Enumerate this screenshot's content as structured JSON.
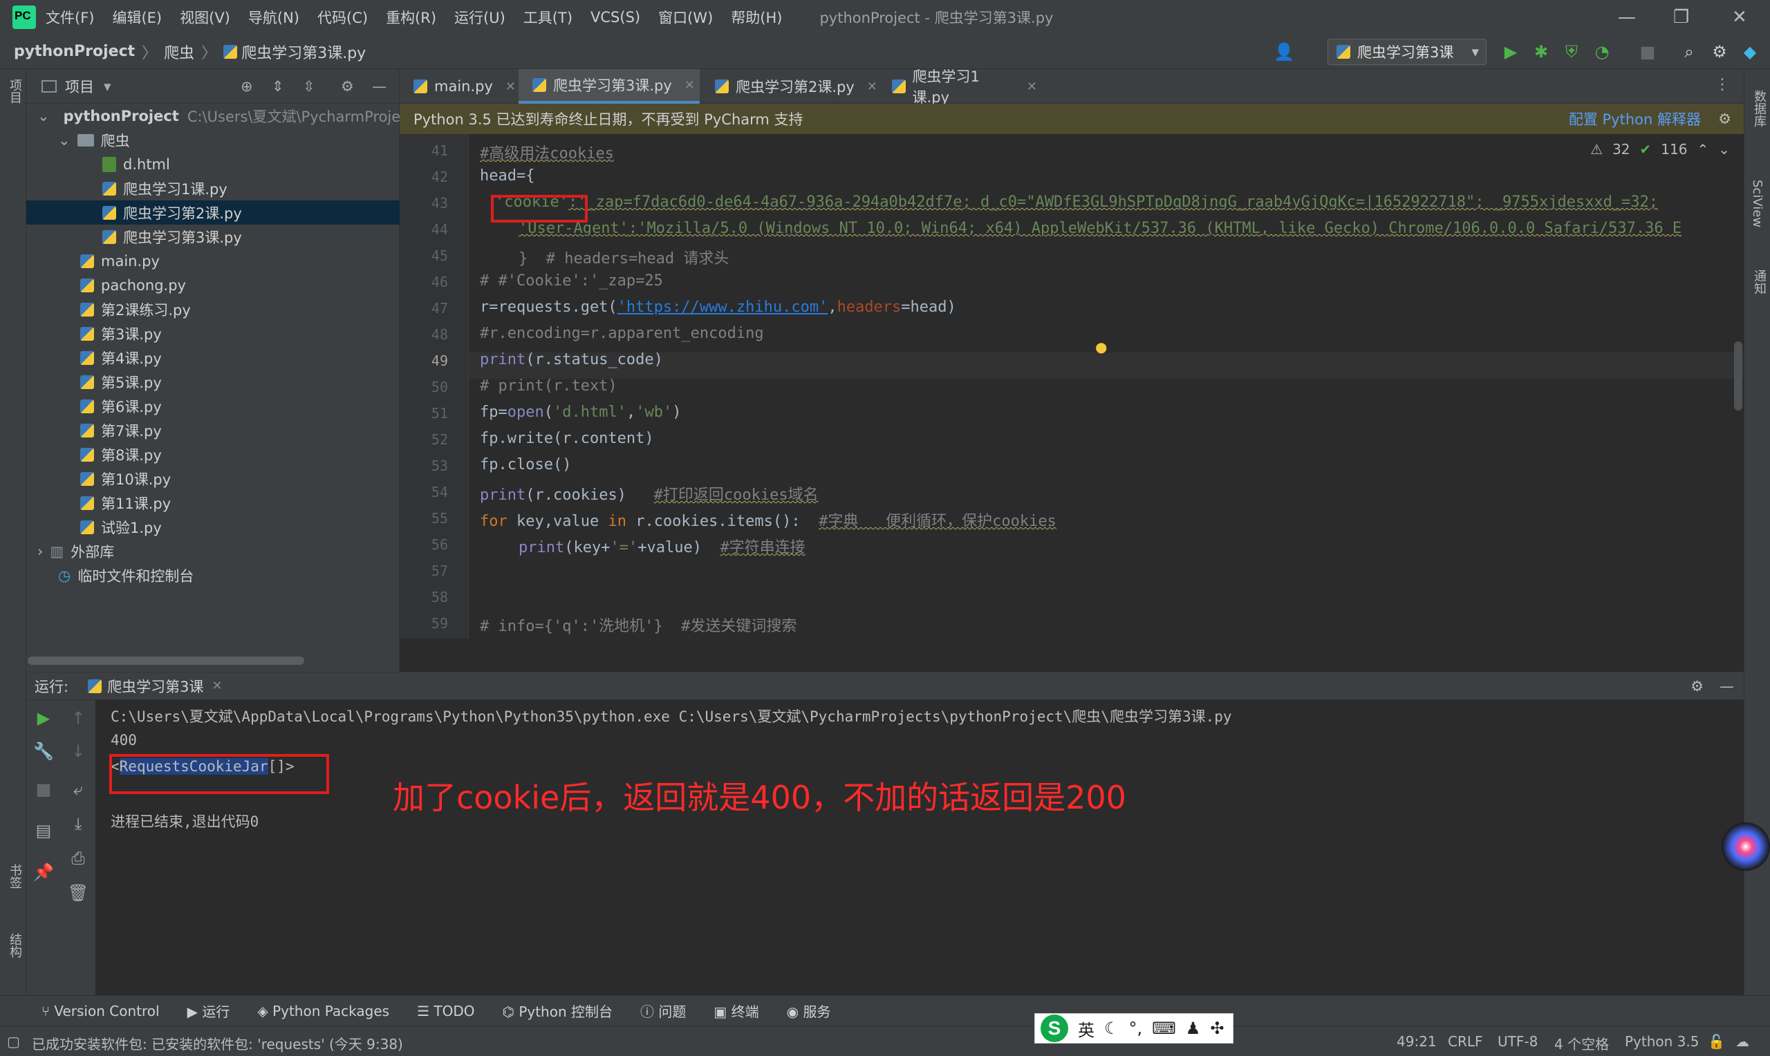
{
  "menubar": {
    "items": [
      "文件(F)",
      "编辑(E)",
      "视图(V)",
      "导航(N)",
      "代码(C)",
      "重构(R)",
      "运行(U)",
      "工具(T)",
      "VCS(S)",
      "窗口(W)",
      "帮助(H)"
    ],
    "title": "pythonProject - 爬虫学习第3课.py"
  },
  "navbar": {
    "crumbs": [
      "pythonProject",
      "爬虫",
      "爬虫学习第3课.py"
    ],
    "run_config": "爬虫学习第3课"
  },
  "sidebar_labels": {
    "left_top": "项目",
    "left_bookmarks": "书签",
    "left_structure": "结构",
    "right_db": "数据库",
    "right_sciview": "SciView",
    "right_notif": "通知"
  },
  "project": {
    "header": "项目",
    "root": "pythonProject",
    "root_path": "C:\\Users\\夏文斌\\PycharmProje",
    "folder": "爬虫",
    "folder_files": [
      "d.html",
      "爬虫学习1课.py",
      "爬虫学习第2课.py",
      "爬虫学习第3课.py"
    ],
    "files": [
      "main.py",
      "pachong.py",
      "第2课练习.py",
      "第3课.py",
      "第4课.py",
      "第5课.py",
      "第6课.py",
      "第7课.py",
      "第8课.py",
      "第10课.py",
      "第11课.py",
      "试验1.py"
    ],
    "external": "外部库",
    "scratch": "临时文件和控制台"
  },
  "tabs": [
    "main.py",
    "爬虫学习第3课.py",
    "爬虫学习第2课.py",
    "爬虫学习1课.py"
  ],
  "banner": {
    "text": "Python 3.5 已达到寿命终止日期，不再受到 PyCharm 支持",
    "link": "配置 Python 解释器"
  },
  "inspections": {
    "warnings": "32",
    "ok": "116"
  },
  "code": {
    "line_numbers": [
      "41",
      "42",
      "43",
      "44",
      "45",
      "46",
      "47",
      "48",
      "49",
      "50",
      "51",
      "52",
      "53",
      "54",
      "55",
      "56",
      "57",
      "58",
      "59"
    ],
    "l41": "#高级用法cookies",
    "l42": "head={",
    "l43_key": "'cookie'",
    "l43_rest": ":'_zap=f7dac6d0-de64-4a67-936a-294a0b42df7e; d_c0=\"AWDfE3GL9hSPTpDqD8jngG_raab4yGjQgKc=|1652922718\"; _9755xjdesxxd_=32;",
    "l44_key": "'User-Agent'",
    "l44_rest": ":'Mozilla/5.0 (Windows NT 10.0; Win64; x64) AppleWebKit/537.36 (KHTML, like Gecko) Chrome/106.0.0.0 Safari/537.36 E",
    "l45": "}  # headers=head 请求头",
    "l46": "# #'Cookie':'_zap=25",
    "l47_a": "r=requests.get(",
    "l47_url": "'https://www.zhihu.com'",
    "l47_b": ",",
    "l47_prm": "headers",
    "l47_c": "=head)",
    "l48": "#r.encoding=r.apparent_encoding",
    "l49_fn": "print",
    "l49_rest": "(r.status_code)",
    "l50": "# print(r.text)",
    "l51_a": "fp=",
    "l51_fn": "open",
    "l51_b": "(",
    "l51_s1": "'d.html'",
    "l51_c": ",",
    "l51_s2": "'wb'",
    "l51_d": ")",
    "l52": "fp.write(r.content)",
    "l53": "fp.close()",
    "l54_fn": "print",
    "l54_rest": "(r.cookies)   ",
    "l54_cmt": "#打印返回cookies域名",
    "l55_kw1": "for",
    "l55_a": " key,value ",
    "l55_kw2": "in",
    "l55_b": " r.cookies.items():  ",
    "l55_cmt": "#字典   便利循环，保护cookies",
    "l56_fn": "print",
    "l56_a": "(key+",
    "l56_s": "'='",
    "l56_b": "+value)  ",
    "l56_cmt": "#字符串连接",
    "l59": "# info={'q':'洗地机'}  #发送关键词搜索"
  },
  "run": {
    "label": "运行:",
    "tab": "爬虫学习第3课",
    "cmd": "C:\\Users\\夏文斌\\AppData\\Local\\Programs\\Python\\Python35\\python.exe C:\\Users\\夏文斌\\PycharmProjects\\pythonProject\\爬虫\\爬虫学习第3课.py",
    "out1": "400",
    "out2_pre": "<",
    "out2_sel": "RequestsCookieJar",
    "out2_post": "[]>",
    "exit": "进程已结束,退出代码0",
    "annotation": "加了cookie后，返回就是400，不加的话返回是200"
  },
  "bottom_tabs": [
    "Version Control",
    "运行",
    "Python Packages",
    "TODO",
    "Python 控制台",
    "问题",
    "终端",
    "服务"
  ],
  "status": {
    "message": "已成功安装软件包: 已安装的软件包: 'requests' (今天 9:38)",
    "position": "49:21",
    "line_sep": "CRLF",
    "encoding": "UTF-8",
    "indent": "4 个空格",
    "interpreter": "Python 3.5"
  },
  "ime": {
    "lang": "英"
  }
}
